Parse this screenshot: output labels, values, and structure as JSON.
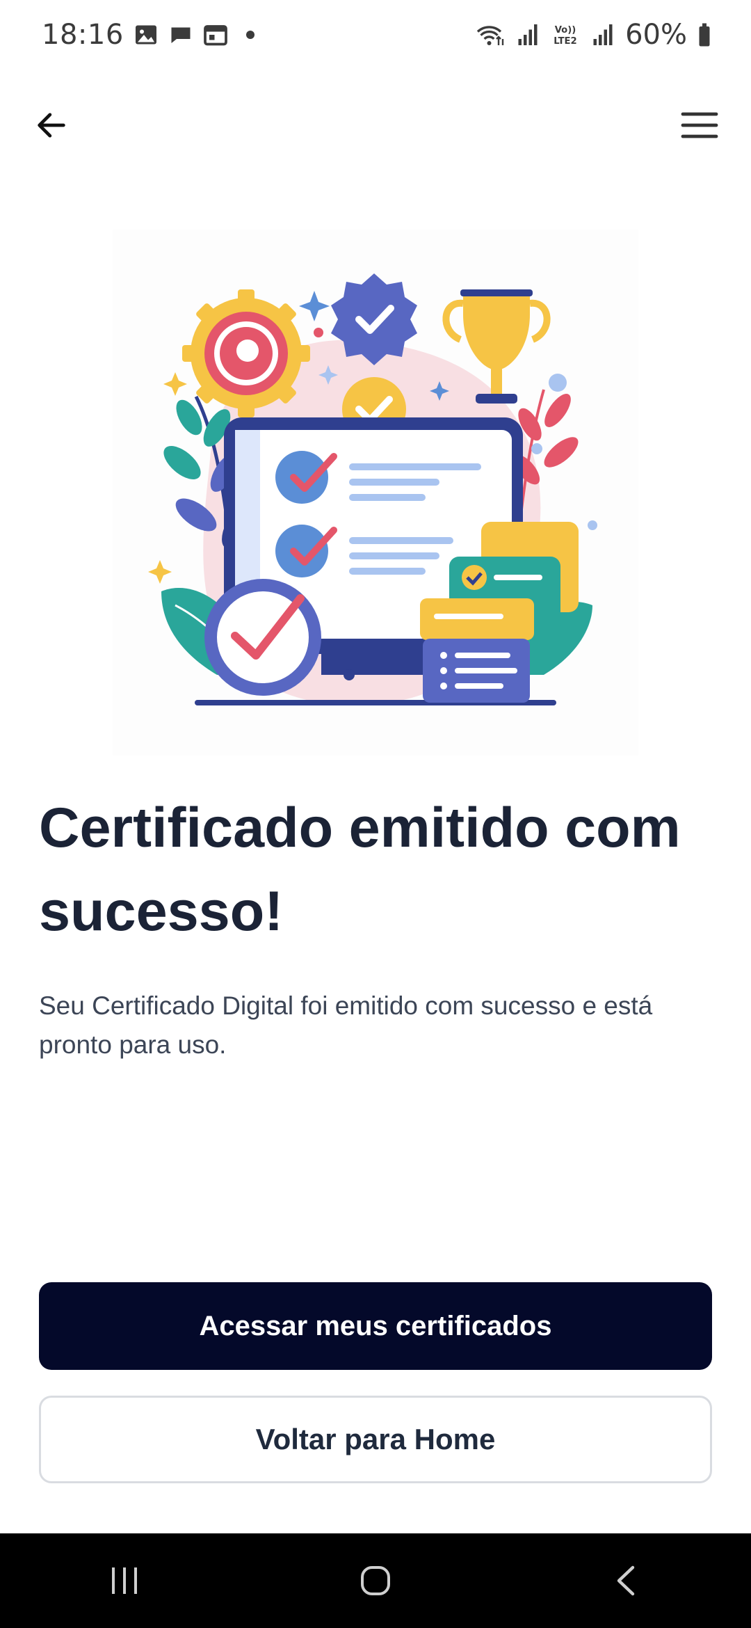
{
  "status_bar": {
    "time": "18:16",
    "battery": "60%",
    "left_icons": [
      "gallery-icon",
      "message-icon",
      "calendar-icon",
      "dot-icon"
    ],
    "right_icons": [
      "wifi-icon",
      "signal-icon",
      "volte-icon",
      "signal-icon",
      "battery-icon"
    ],
    "volte_text": "Vo)) LTE2"
  },
  "header": {
    "back_icon": "arrow-left-icon",
    "menu_icon": "hamburger-menu-icon"
  },
  "illustration": {
    "name": "certificate-success-illustration"
  },
  "content": {
    "title": "Certificado emitido com sucesso!",
    "description": "Seu Certificado Digital foi emitido com sucesso e está pronto para uso."
  },
  "actions": {
    "primary_label": "Acessar meus certificados",
    "secondary_label": "Voltar para Home"
  },
  "nav_bar": {
    "icons": [
      "recent-apps-icon",
      "home-icon",
      "back-icon"
    ]
  },
  "colors": {
    "primary_button": "#04092a",
    "title": "#1b2336",
    "text": "#3c4556",
    "accent_blue": "#3a4fa3",
    "accent_red": "#e4566a",
    "accent_yellow": "#f6c445"
  }
}
